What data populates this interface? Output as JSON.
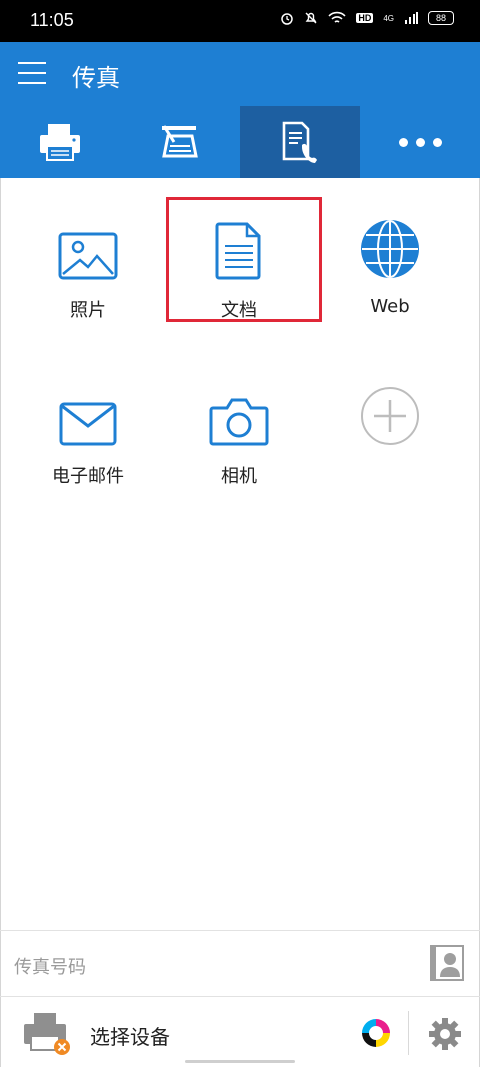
{
  "status_bar": {
    "time": "11:05",
    "battery": "88",
    "network": "4G",
    "hd": "HD"
  },
  "app_bar": {
    "title": "传真"
  },
  "tabs": [
    {
      "name": "print",
      "icon": "printer-icon"
    },
    {
      "name": "scan",
      "icon": "scanner-icon"
    },
    {
      "name": "fax",
      "icon": "fax-document-icon",
      "active": true
    },
    {
      "name": "more",
      "icon": "more-icon"
    }
  ],
  "sources": {
    "photo": "照片",
    "document": "文档",
    "web": "Web",
    "email": "电子邮件",
    "camera": "相机"
  },
  "fax_number": {
    "placeholder": "传真号码"
  },
  "device_bar": {
    "label": "选择设备"
  },
  "colors": {
    "primary": "#1e7fd3",
    "active_tab": "#1d5fa1",
    "highlight": "#e02838",
    "icon_blue": "#1e7fd3"
  }
}
